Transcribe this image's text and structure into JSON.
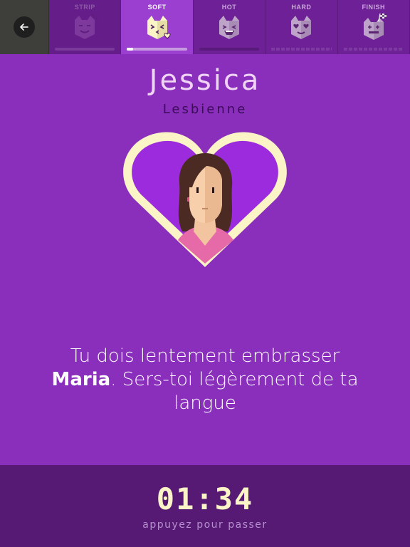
{
  "levels": [
    {
      "label": "STRIP",
      "icon": "strip-cat-icon",
      "state": "done",
      "progress": 1.0
    },
    {
      "label": "SOFT",
      "icon": "kissing-cat-icon",
      "state": "active",
      "progress": 0.1
    },
    {
      "label": "HOT",
      "icon": "grinning-cat-icon",
      "state": "upcoming",
      "progress": 0
    },
    {
      "label": "HARD",
      "icon": "heart-eyes-cat-icon",
      "state": "upcoming",
      "progress": 0
    },
    {
      "label": "FINISH",
      "icon": "finish-flag-cat-icon",
      "state": "upcoming",
      "progress": 0
    }
  ],
  "player": {
    "name": "Jessica",
    "orientation": "Lesbienne",
    "avatar": "woman-avatar-icon"
  },
  "instruction": {
    "before": "Tu dois lentement embrasser ",
    "partner": "Maria",
    "after": ". Sers-toi légèrement de ta langue"
  },
  "timer": {
    "value": "01:34",
    "hint": "appuyez pour passer"
  },
  "colors": {
    "background": "#8a2ebc",
    "footer": "#561a74",
    "heart_border": "#fbf4c7",
    "heart_fill": "#9b2bdc",
    "timer_text": "#fbf4c7"
  }
}
